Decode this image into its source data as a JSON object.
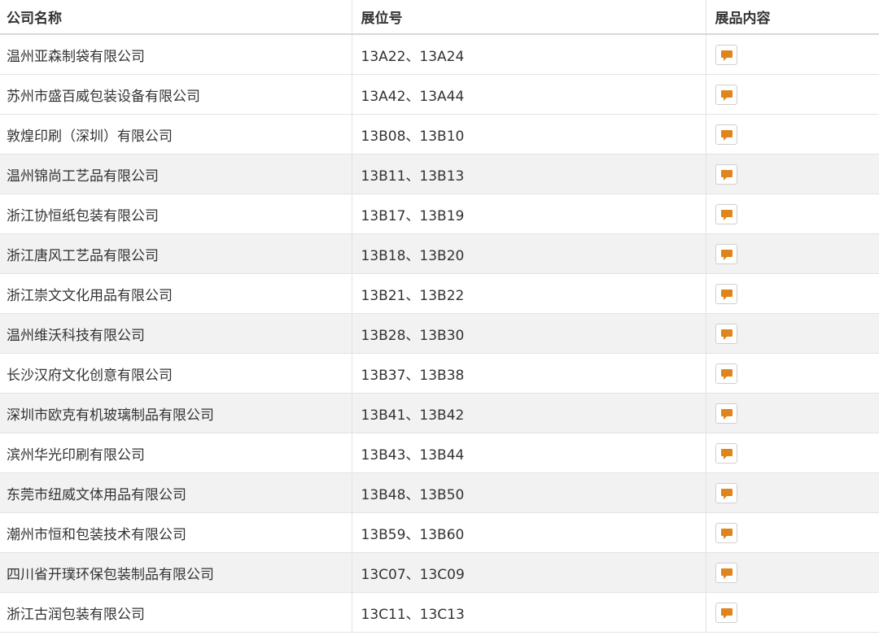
{
  "header": {
    "company": "公司名称",
    "booth": "展位号",
    "content": "展品内容"
  },
  "colors": {
    "icon": "#e0851c",
    "alt_row": "#f2f2f2"
  },
  "rows": [
    {
      "company": "温州亚森制袋有限公司",
      "booth": "13A22、13A24",
      "icon": "chat-icon"
    },
    {
      "company": "苏州市盛百威包装设备有限公司",
      "booth": "13A42、13A44",
      "icon": "chat-icon"
    },
    {
      "company": "敦煌印刷（深圳）有限公司",
      "booth": "13B08、13B10",
      "icon": "chat-icon"
    },
    {
      "company": "温州锦尚工艺品有限公司",
      "booth": "13B11、13B13",
      "icon": "chat-icon"
    },
    {
      "company": "浙江协恒纸包装有限公司",
      "booth": "13B17、13B19",
      "icon": "chat-icon"
    },
    {
      "company": "浙江唐风工艺品有限公司",
      "booth": "13B18、13B20",
      "icon": "chat-icon"
    },
    {
      "company": "浙江崇文文化用品有限公司",
      "booth": "13B21、13B22",
      "icon": "chat-icon"
    },
    {
      "company": "温州维沃科技有限公司",
      "booth": "13B28、13B30",
      "icon": "chat-icon"
    },
    {
      "company": "长沙汉府文化创意有限公司",
      "booth": "13B37、13B38",
      "icon": "chat-icon"
    },
    {
      "company": "深圳市欧克有机玻璃制品有限公司",
      "booth": "13B41、13B42",
      "icon": "chat-icon"
    },
    {
      "company": "滨州华光印刷有限公司",
      "booth": "13B43、13B44",
      "icon": "chat-icon"
    },
    {
      "company": "东莞市纽威文体用品有限公司",
      "booth": "13B48、13B50",
      "icon": "chat-icon"
    },
    {
      "company": "潮州市恒和包装技术有限公司",
      "booth": "13B59、13B60",
      "icon": "chat-icon"
    },
    {
      "company": "四川省开璞环保包装制品有限公司",
      "booth": "13C07、13C09",
      "icon": "chat-icon"
    },
    {
      "company": "浙江古润包装有限公司",
      "booth": "13C11、13C13",
      "icon": "chat-icon"
    }
  ]
}
